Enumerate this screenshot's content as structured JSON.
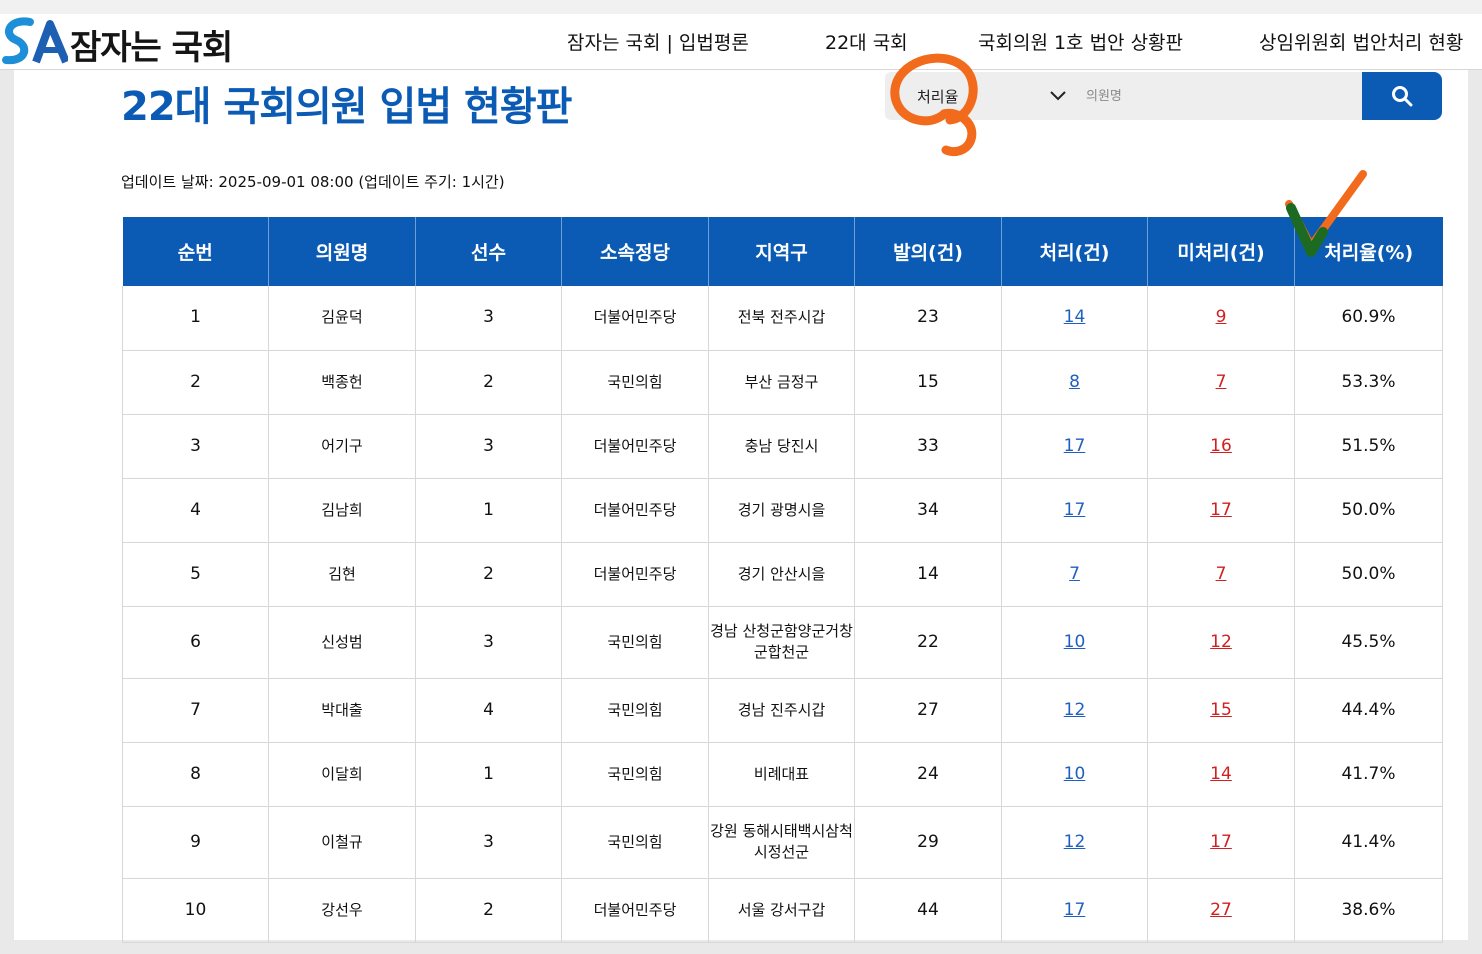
{
  "logo": {
    "mark": "SA",
    "text": "잠자는 국회"
  },
  "nav": [
    {
      "label": "잠자는 국회 | 입법평론"
    },
    {
      "label": "22대 국회"
    },
    {
      "label": "국회의원 1호 법안 상황판"
    },
    {
      "label": "상임위원회 법안처리 현황"
    }
  ],
  "page_title": "22대 국회의원 입법 현황판",
  "search": {
    "sort_selected": "처리율",
    "input_placeholder": "의원명",
    "input_value": "",
    "button_icon": "search-icon"
  },
  "update_text": "업데이트 날짜: 2025-09-01 08:00 (업데이트 주기: 1시간)",
  "table": {
    "headers": [
      "순번",
      "의원명",
      "선수",
      "소속정당",
      "지역구",
      "발의(건)",
      "처리(건)",
      "미처리(건)",
      "처리율(%)"
    ],
    "rows": [
      {
        "no": "1",
        "name": "김윤덕",
        "terms": "3",
        "party": "더불어민주당",
        "district": "전북 전주시갑",
        "proposed": "23",
        "processed": "14",
        "unprocessed": "9",
        "rate": "60.9%"
      },
      {
        "no": "2",
        "name": "백종헌",
        "terms": "2",
        "party": "국민의힘",
        "district": "부산 금정구",
        "proposed": "15",
        "processed": "8",
        "unprocessed": "7",
        "rate": "53.3%"
      },
      {
        "no": "3",
        "name": "어기구",
        "terms": "3",
        "party": "더불어민주당",
        "district": "충남 당진시",
        "proposed": "33",
        "processed": "17",
        "unprocessed": "16",
        "rate": "51.5%"
      },
      {
        "no": "4",
        "name": "김남희",
        "terms": "1",
        "party": "더불어민주당",
        "district": "경기 광명시을",
        "proposed": "34",
        "processed": "17",
        "unprocessed": "17",
        "rate": "50.0%"
      },
      {
        "no": "5",
        "name": "김현",
        "terms": "2",
        "party": "더불어민주당",
        "district": "경기 안산시을",
        "proposed": "14",
        "processed": "7",
        "unprocessed": "7",
        "rate": "50.0%"
      },
      {
        "no": "6",
        "name": "신성범",
        "terms": "3",
        "party": "국민의힘",
        "district": "경남 산청군함양군거창군합천군",
        "proposed": "22",
        "processed": "10",
        "unprocessed": "12",
        "rate": "45.5%"
      },
      {
        "no": "7",
        "name": "박대출",
        "terms": "4",
        "party": "국민의힘",
        "district": "경남 진주시갑",
        "proposed": "27",
        "processed": "12",
        "unprocessed": "15",
        "rate": "44.4%"
      },
      {
        "no": "8",
        "name": "이달희",
        "terms": "1",
        "party": "국민의힘",
        "district": "비례대표",
        "proposed": "24",
        "processed": "10",
        "unprocessed": "14",
        "rate": "41.7%"
      },
      {
        "no": "9",
        "name": "이철규",
        "terms": "3",
        "party": "국민의힘",
        "district": "강원 동해시태백시삼척시정선군",
        "proposed": "29",
        "processed": "12",
        "unprocessed": "17",
        "rate": "41.4%"
      },
      {
        "no": "10",
        "name": "강선우",
        "terms": "2",
        "party": "더불어민주당",
        "district": "서울 강서구갑",
        "proposed": "44",
        "processed": "17",
        "unprocessed": "27",
        "rate": "38.6%"
      }
    ]
  },
  "colors": {
    "brand_blue": "#0b5bb5",
    "processed_link": "#1f5fbf",
    "unprocessed_link": "#d21f1f",
    "annotation_orange": "#f26a1b",
    "annotation_check": "#1d6b22"
  }
}
